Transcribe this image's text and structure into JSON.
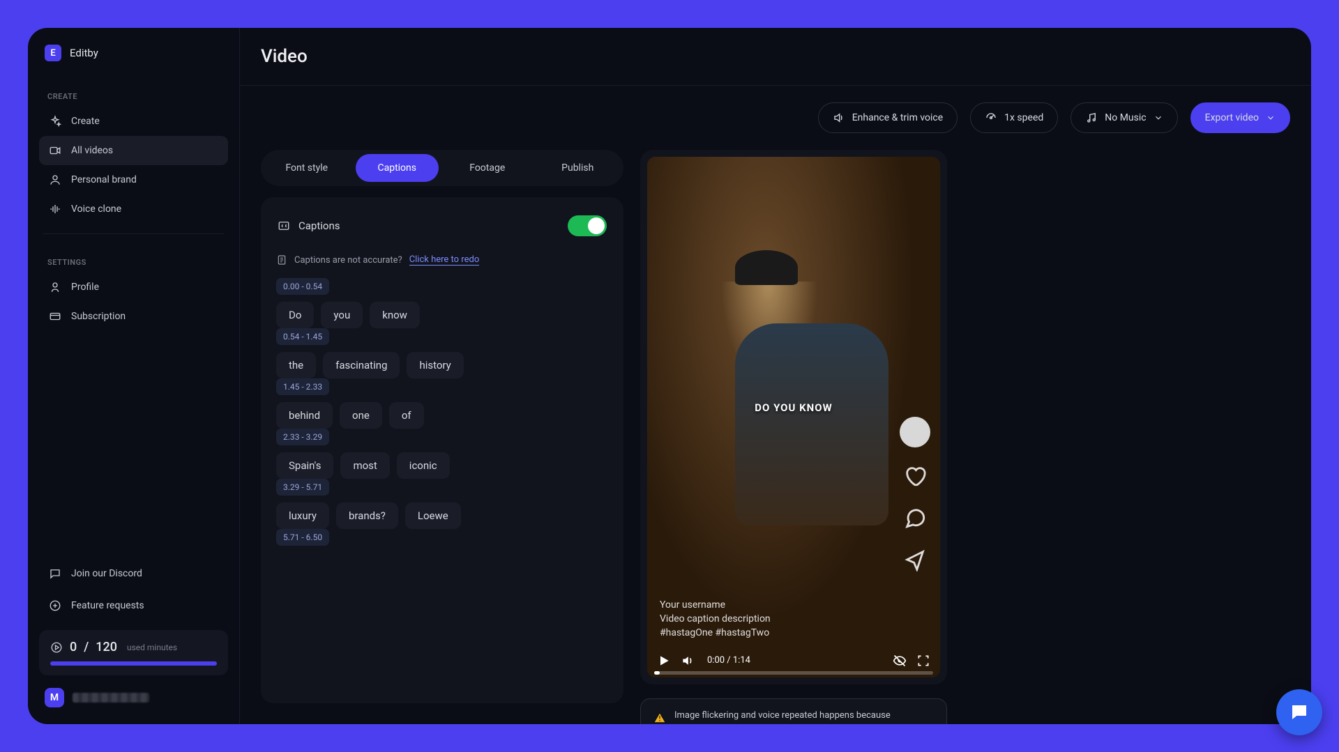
{
  "brand": {
    "initial": "E",
    "name": "Editby"
  },
  "sidebar": {
    "create_label": "CREATE",
    "settings_label": "SETTINGS",
    "create_items": [
      {
        "label": "Create"
      },
      {
        "label": "All videos"
      },
      {
        "label": "Personal brand"
      },
      {
        "label": "Voice clone"
      }
    ],
    "settings_items": [
      {
        "label": "Profile"
      },
      {
        "label": "Subscription"
      }
    ],
    "bottom_items": [
      {
        "label": "Join our Discord"
      },
      {
        "label": "Feature requests"
      }
    ],
    "usage": {
      "used": "0",
      "total": "120",
      "suffix": "used minutes"
    },
    "avatar_initial": "M"
  },
  "page_title": "Video",
  "toolbar": {
    "enhance": "Enhance & trim voice",
    "speed": "1x speed",
    "music": "No Music",
    "export": "Export video"
  },
  "tabs": [
    "Font style",
    "Captions",
    "Footage",
    "Publish"
  ],
  "active_tab": 1,
  "captions": {
    "heading": "Captions",
    "accuracy_text": "Captions are not accurate?",
    "accuracy_link": "Click here to redo",
    "blocks": [
      {
        "time": "0.00 - 0.54",
        "words": [
          "Do",
          "you",
          "know"
        ]
      },
      {
        "time": "0.54 - 1.45",
        "words": [
          "the",
          "fascinating",
          "history"
        ]
      },
      {
        "time": "1.45 - 2.33",
        "words": [
          "behind",
          "one",
          "of"
        ]
      },
      {
        "time": "2.33 - 3.29",
        "words": [
          "Spain's",
          "most",
          "iconic"
        ]
      },
      {
        "time": "3.29 - 5.71",
        "words": [
          "luxury",
          "brands?",
          "Loewe"
        ]
      },
      {
        "time": "5.71 - 6.50",
        "words": []
      }
    ]
  },
  "preview": {
    "caption_overlay": "DO YOU KNOW",
    "username": "Your username",
    "description": "Video caption description",
    "hashtags": "#hastagOne #hastagTwo",
    "time_current": "0:00",
    "time_total": "1:14"
  },
  "warning": "Image flickering and voice repeated happens because"
}
